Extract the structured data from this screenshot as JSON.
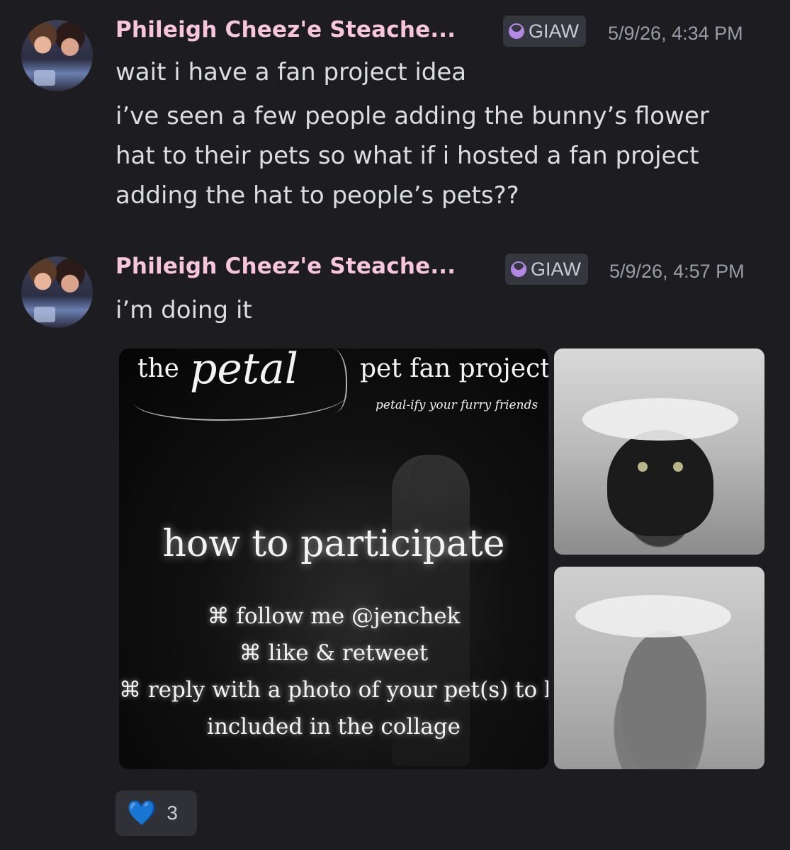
{
  "messages": [
    {
      "author": "Phileigh Cheez'e Steache...",
      "tag": "GIAW",
      "timestamp": "5/9/26, 4:34 PM",
      "lines": [
        "wait i have a fan project idea",
        "i’ve seen a few people adding the bunny’s flower hat to their pets so what if i hosted a fan project adding the hat to people’s pets??"
      ]
    },
    {
      "author": "Phileigh Cheez'e Steache...",
      "tag": "GIAW",
      "timestamp": "5/9/26, 4:57 PM",
      "lines": [
        "i’m doing it"
      ]
    }
  ],
  "poster": {
    "the": "the",
    "petal": "petal",
    "title": "pet fan project",
    "subtitle": "petal-ify your furry friends",
    "heading": "how to participate",
    "steps": [
      "⌘ follow me @jenchek",
      "⌘ like & retweet",
      "⌘ reply with a photo of your pet(s) to be",
      "included in the collage"
    ]
  },
  "reaction": {
    "emoji": "💙",
    "count": "3"
  },
  "icons": {
    "tag_icon": "crescent-moon-icon",
    "reaction_icon": "blue-heart-icon"
  },
  "colors": {
    "background": "#1c1c21",
    "author_name": "#f7c5dc",
    "tag_icon": "#b58ae6"
  }
}
